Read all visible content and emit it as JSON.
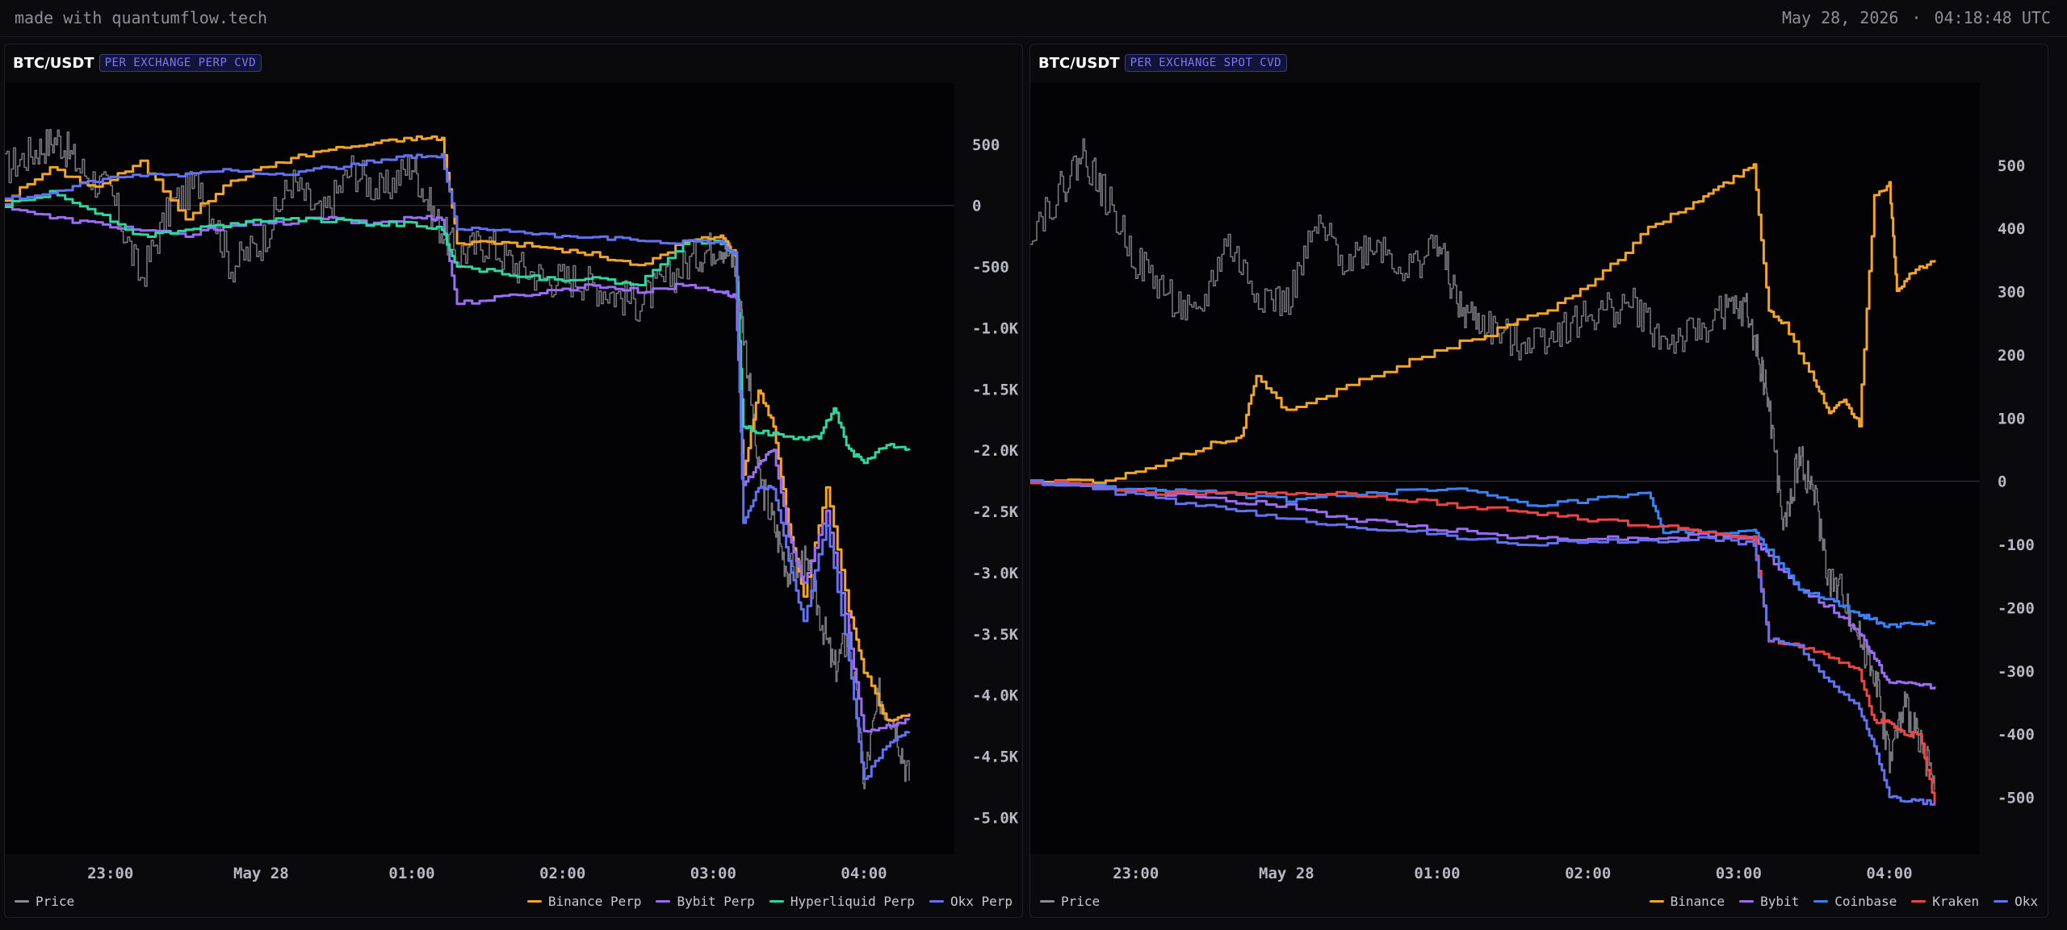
{
  "header": {
    "brand": "made with quantumflow.tech",
    "date": "May 28, 2026",
    "separator": "·",
    "time": "04:18:48 UTC"
  },
  "chart_data": [
    {
      "type": "line",
      "pair": "BTC/USDT",
      "badge": "PER EXCHANGE PERP CVD",
      "x_ticks": [
        "23:00",
        "May 28",
        "01:00",
        "02:00",
        "03:00",
        "04:00"
      ],
      "x_tick_hours": [
        -1,
        0,
        1,
        2,
        3,
        4
      ],
      "x_range_hours": [
        -1.7,
        4.6
      ],
      "y_ticks": [
        "500",
        "0",
        "-500",
        "-1.0K",
        "-1.5K",
        "-2.0K",
        "-2.5K",
        "-3.0K",
        "-3.5K",
        "-4.0K",
        "-4.5K",
        "-5.0K"
      ],
      "y_tick_values": [
        500,
        0,
        -500,
        -1000,
        -1500,
        -2000,
        -2500,
        -3000,
        -3500,
        -4000,
        -4500,
        -5000
      ],
      "ylim": [
        -5300,
        1000
      ],
      "zero_line": 0,
      "price": {
        "name": "Price",
        "color": "#8a8a92",
        "x": [
          -1.7,
          -1.5,
          -1.35,
          -1.2,
          -1.0,
          -0.8,
          -0.6,
          -0.4,
          -0.2,
          0.0,
          0.2,
          0.4,
          0.6,
          0.8,
          1.0,
          1.15,
          1.3,
          1.5,
          1.7,
          1.9,
          2.1,
          2.3,
          2.5,
          2.7,
          2.9,
          3.05,
          3.15,
          3.2,
          3.3,
          3.4,
          3.5,
          3.6,
          3.7,
          3.8,
          3.9,
          4.0,
          4.1,
          4.2,
          4.3
        ],
        "y": [
          300,
          450,
          550,
          300,
          100,
          -600,
          0,
          200,
          -500,
          -300,
          200,
          -100,
          300,
          100,
          350,
          -100,
          -400,
          -300,
          -500,
          -600,
          -600,
          -700,
          -800,
          -600,
          -400,
          -300,
          -500,
          -1000,
          -2200,
          -2600,
          -3000,
          -2900,
          -3300,
          -3800,
          -3500,
          -4700,
          -4000,
          -4200,
          -4700
        ]
      },
      "series": [
        {
          "name": "Binance Perp",
          "color": "#f5a524",
          "x": [
            -1.7,
            -1.4,
            -1.1,
            -0.8,
            -0.5,
            -0.2,
            0.1,
            0.4,
            0.7,
            1.0,
            1.2,
            1.3,
            1.6,
            1.9,
            2.2,
            2.5,
            2.8,
            3.05,
            3.15,
            3.2,
            3.3,
            3.4,
            3.5,
            3.6,
            3.75,
            3.9,
            4.0,
            4.15,
            4.3
          ],
          "y": [
            50,
            300,
            150,
            350,
            -100,
            200,
            350,
            450,
            500,
            550,
            550,
            -300,
            -300,
            -350,
            -400,
            -500,
            -300,
            -250,
            -400,
            -2200,
            -1500,
            -1800,
            -2600,
            -3200,
            -2300,
            -3300,
            -3800,
            -4200,
            -4150
          ]
        },
        {
          "name": "Bybit Perp",
          "color": "#9b6cf5",
          "x": [
            -1.7,
            -1.4,
            -1.1,
            -0.8,
            -0.5,
            -0.2,
            0.1,
            0.4,
            0.7,
            1.0,
            1.2,
            1.3,
            1.6,
            1.9,
            2.2,
            2.5,
            2.8,
            3.05,
            3.15,
            3.2,
            3.3,
            3.4,
            3.5,
            3.6,
            3.75,
            3.9,
            4.0,
            4.15,
            4.3
          ],
          "y": [
            0,
            -100,
            -150,
            -200,
            -250,
            -150,
            -150,
            -100,
            -150,
            -100,
            -100,
            -800,
            -750,
            -700,
            -650,
            -700,
            -650,
            -700,
            -750,
            -2300,
            -2100,
            -2000,
            -2700,
            -3100,
            -2500,
            -3500,
            -4300,
            -4250,
            -4200
          ]
        },
        {
          "name": "Hyperliquid Perp",
          "color": "#2fd6a0",
          "x": [
            -1.7,
            -1.4,
            -1.1,
            -0.8,
            -0.5,
            -0.2,
            0.1,
            0.4,
            0.7,
            1.0,
            1.2,
            1.3,
            1.6,
            1.9,
            2.2,
            2.5,
            2.8,
            3.05,
            3.15,
            3.2,
            3.3,
            3.5,
            3.7,
            3.8,
            3.9,
            4.0,
            4.15,
            4.3
          ],
          "y": [
            0,
            100,
            -50,
            -250,
            -200,
            -150,
            -100,
            -120,
            -150,
            -150,
            -200,
            -500,
            -550,
            -600,
            -600,
            -650,
            -300,
            -300,
            -400,
            -1800,
            -1850,
            -1900,
            -1900,
            -1650,
            -2000,
            -2100,
            -1950,
            -2000
          ]
        },
        {
          "name": "Okx Perp",
          "color": "#6272f0",
          "x": [
            -1.7,
            -1.4,
            -1.1,
            -0.8,
            -0.5,
            -0.2,
            0.1,
            0.4,
            0.7,
            1.0,
            1.2,
            1.3,
            1.6,
            1.9,
            2.2,
            2.5,
            2.8,
            3.05,
            3.15,
            3.2,
            3.3,
            3.4,
            3.5,
            3.6,
            3.75,
            3.9,
            4.0,
            4.15,
            4.3
          ],
          "y": [
            50,
            100,
            200,
            250,
            250,
            300,
            250,
            300,
            350,
            400,
            400,
            -200,
            -200,
            -250,
            -250,
            -300,
            -300,
            -300,
            -400,
            -2600,
            -2300,
            -2300,
            -2900,
            -3400,
            -2600,
            -3700,
            -4700,
            -4400,
            -4300
          ]
        }
      ]
    },
    {
      "type": "line",
      "pair": "BTC/USDT",
      "badge": "PER EXCHANGE SPOT CVD",
      "x_ticks": [
        "23:00",
        "May 28",
        "01:00",
        "02:00",
        "03:00",
        "04:00"
      ],
      "x_tick_hours": [
        -1,
        0,
        1,
        2,
        3,
        4
      ],
      "x_range_hours": [
        -1.7,
        4.6
      ],
      "y_ticks": [
        "500",
        "400",
        "300",
        "200",
        "100",
        "0",
        "-100",
        "-200",
        "-300",
        "-400",
        "-500"
      ],
      "y_tick_values": [
        500,
        400,
        300,
        200,
        100,
        0,
        -100,
        -200,
        -300,
        -400,
        -500
      ],
      "ylim": [
        -590,
        630
      ],
      "zero_line": 0,
      "price": {
        "name": "Price",
        "color": "#8a8a92",
        "x": [
          -1.7,
          -1.5,
          -1.35,
          -1.2,
          -1.0,
          -0.8,
          -0.6,
          -0.4,
          -0.2,
          0.0,
          0.2,
          0.4,
          0.6,
          0.8,
          1.0,
          1.15,
          1.3,
          1.5,
          1.7,
          1.9,
          2.1,
          2.3,
          2.5,
          2.7,
          2.9,
          3.05,
          3.15,
          3.2,
          3.3,
          3.4,
          3.5,
          3.6,
          3.7,
          3.8,
          3.9,
          4.0,
          4.1,
          4.2,
          4.3
        ],
        "y": [
          400,
          460,
          520,
          450,
          350,
          300,
          250,
          380,
          300,
          280,
          400,
          350,
          380,
          330,
          380,
          270,
          250,
          220,
          230,
          250,
          270,
          280,
          220,
          230,
          270,
          270,
          180,
          120,
          -80,
          40,
          -20,
          -160,
          -180,
          -250,
          -300,
          -440,
          -360,
          -400,
          -490
        ]
      },
      "series": [
        {
          "name": "Binance",
          "color": "#f5a524",
          "x": [
            -1.7,
            -1.2,
            -0.8,
            -0.5,
            -0.3,
            -0.2,
            0.0,
            0.4,
            0.9,
            1.4,
            1.8,
            2.1,
            2.4,
            2.7,
            2.9,
            3.1,
            3.2,
            3.3,
            3.5,
            3.6,
            3.7,
            3.8,
            3.9,
            4.0,
            4.05,
            4.15,
            4.3
          ],
          "y": [
            0,
            0,
            30,
            60,
            70,
            170,
            110,
            150,
            200,
            240,
            280,
            330,
            400,
            440,
            470,
            500,
            270,
            250,
            160,
            110,
            130,
            90,
            450,
            470,
            300,
            330,
            350
          ]
        },
        {
          "name": "Bybit",
          "color": "#9b6cf5",
          "x": [
            -1.7,
            -1.2,
            -0.8,
            -0.4,
            0.0,
            0.4,
            0.8,
            1.2,
            1.6,
            2.0,
            2.4,
            2.8,
            3.1,
            3.2,
            3.4,
            3.6,
            3.8,
            3.9,
            4.0,
            4.15,
            4.3
          ],
          "y": [
            0,
            -10,
            -20,
            -30,
            -40,
            -60,
            -70,
            -80,
            -90,
            -90,
            -90,
            -85,
            -90,
            -120,
            -170,
            -200,
            -240,
            -280,
            -320,
            -320,
            -325
          ]
        },
        {
          "name": "Coinbase",
          "color": "#3b82f6",
          "x": [
            -1.7,
            -1.2,
            -0.8,
            -0.4,
            0.0,
            0.4,
            0.8,
            1.2,
            1.6,
            2.0,
            2.4,
            2.5,
            2.8,
            3.1,
            3.2,
            3.4,
            3.6,
            3.8,
            3.9,
            4.0,
            4.15,
            4.3
          ],
          "y": [
            0,
            -10,
            -15,
            -20,
            -30,
            -20,
            -15,
            -15,
            -40,
            -30,
            -20,
            -80,
            -80,
            -80,
            -110,
            -170,
            -190,
            -210,
            -220,
            -230,
            -225,
            -225
          ]
        },
        {
          "name": "Kraken",
          "color": "#ef4444",
          "x": [
            -1.7,
            -1.2,
            -0.8,
            -0.4,
            0.0,
            0.4,
            0.8,
            1.2,
            1.6,
            2.0,
            2.4,
            2.8,
            3.1,
            3.2,
            3.4,
            3.6,
            3.8,
            3.9,
            4.0,
            4.1,
            4.2,
            4.3
          ],
          "y": [
            0,
            -10,
            -20,
            -15,
            -20,
            -20,
            -30,
            -40,
            -50,
            -60,
            -70,
            -80,
            -90,
            -250,
            -260,
            -280,
            -300,
            -380,
            -380,
            -400,
            -400,
            -510
          ]
        },
        {
          "name": "Okx",
          "color": "#6272f0",
          "x": [
            -1.7,
            -1.2,
            -0.8,
            -0.4,
            0.0,
            0.4,
            0.8,
            1.2,
            1.6,
            2.0,
            2.4,
            2.8,
            3.1,
            3.2,
            3.4,
            3.6,
            3.8,
            3.9,
            4.0,
            4.15,
            4.3
          ],
          "y": [
            0,
            -15,
            -30,
            -45,
            -60,
            -70,
            -80,
            -90,
            -100,
            -95,
            -95,
            -90,
            -100,
            -250,
            -260,
            -320,
            -360,
            -420,
            -500,
            -505,
            -510
          ]
        }
      ]
    }
  ]
}
